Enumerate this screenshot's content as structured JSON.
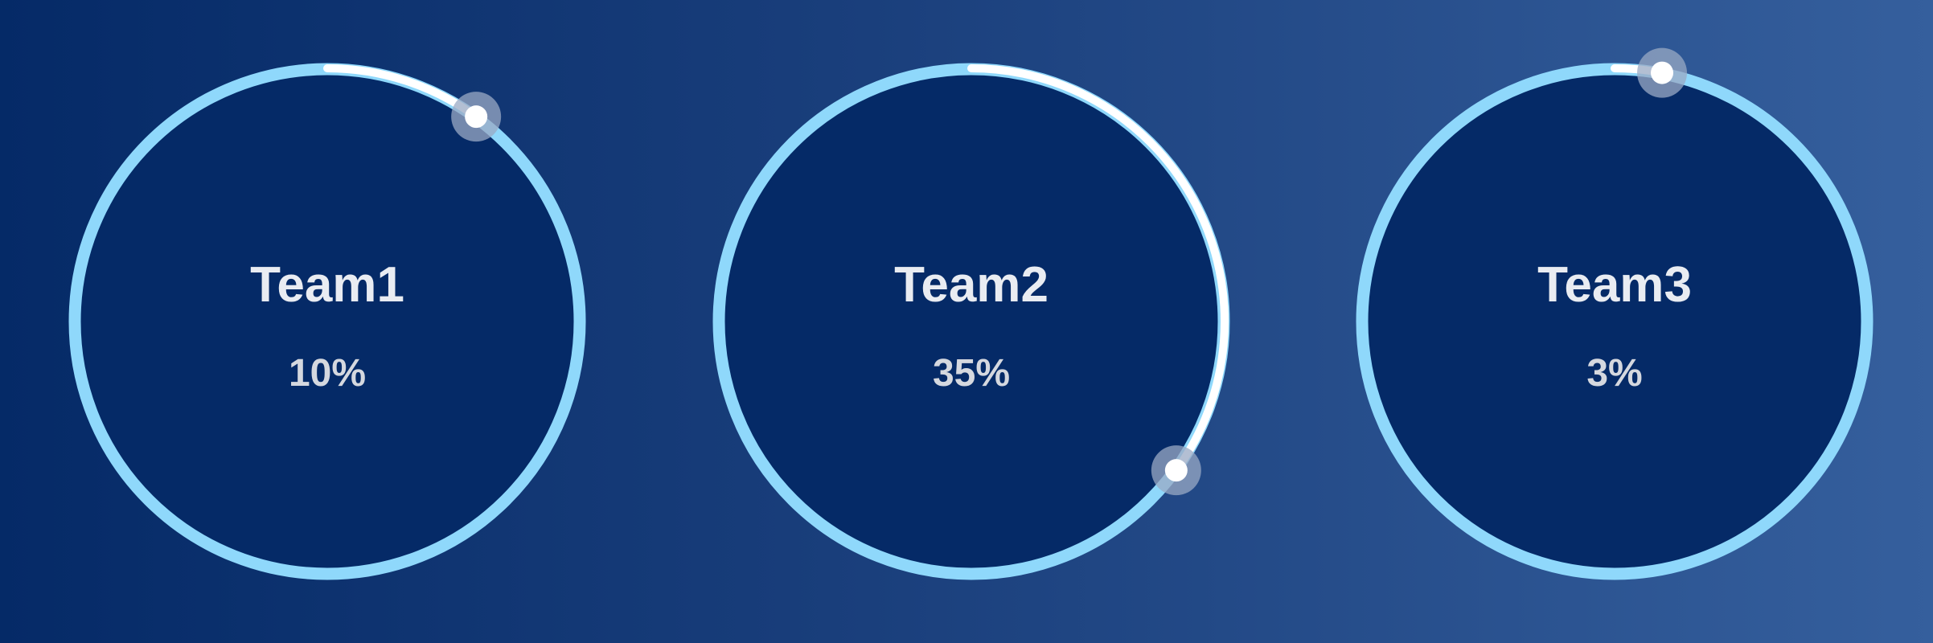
{
  "colors": {
    "inner_fill": "#052a67",
    "track": "#8fd8fb",
    "progress": "#ffffff",
    "knob_halo": "#9aa9c4",
    "label_text": "#e9ecf2",
    "value_text": "#d5d8df"
  },
  "chart_data": {
    "type": "progress-ring",
    "teams": [
      {
        "label": "Team1",
        "value": 10,
        "display": "10%"
      },
      {
        "label": "Team2",
        "value": 35,
        "display": "35%"
      },
      {
        "label": "Team3",
        "value": 3,
        "display": "3%"
      }
    ]
  }
}
